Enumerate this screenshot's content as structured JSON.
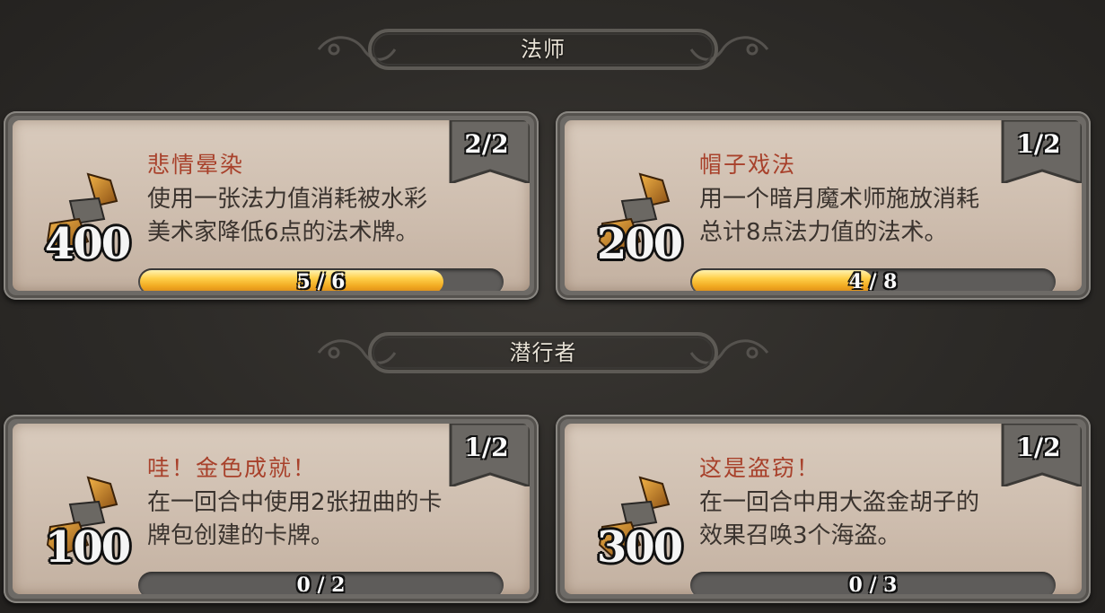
{
  "sections": [
    {
      "title": "法师",
      "quests": [
        {
          "name": "悲情晕染",
          "desc_line1": "使用一张法力值消耗被水彩",
          "desc_line2": "美术家降低6点的法术牌。",
          "reward": "400",
          "completion": "2/2",
          "progress_text": "5 / 6",
          "progress_fraction": 0.833
        },
        {
          "name": "帽子戏法",
          "desc_line1": "用一个暗月魔术师施放消耗",
          "desc_line2": "总计8点法力值的法术。",
          "reward": "200",
          "completion": "1/2",
          "progress_text": "4 / 8",
          "progress_fraction": 0.5
        }
      ]
    },
    {
      "title": "潜行者",
      "quests": [
        {
          "name": "哇！金色成就！",
          "desc_line1": "在一回合中使用2张扭曲的卡",
          "desc_line2": "牌包创建的卡牌。",
          "reward": "100",
          "completion": "1/2",
          "progress_text": "0 / 2",
          "progress_fraction": 0
        },
        {
          "name": "这是盗窃！",
          "desc_line1": "在一回合中用大盗金胡子的",
          "desc_line2": "效果召唤3个海盗。",
          "reward": "300",
          "completion": "1/2",
          "progress_text": "0 / 3",
          "progress_fraction": 0
        }
      ]
    }
  ],
  "icons": {
    "reward": "gold-scroll-icon"
  },
  "colors": {
    "title": "#a8412b",
    "progress_fill": "#f0a820"
  }
}
